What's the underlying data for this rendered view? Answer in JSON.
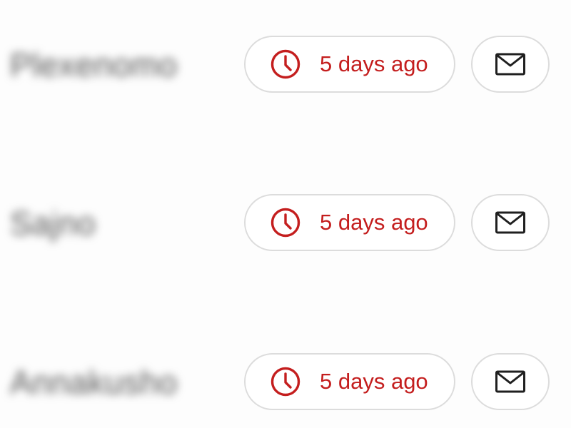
{
  "accent_color": "#c41e1e",
  "icon_color": "#1f1f1f",
  "rows": [
    {
      "name": "Plexenomo",
      "time_label": "5 days ago",
      "time_icon": "clock-icon",
      "mail_icon": "mail-icon"
    },
    {
      "name": "Sajno",
      "time_label": "5 days ago",
      "time_icon": "clock-icon",
      "mail_icon": "mail-icon"
    },
    {
      "name": "Annakusho",
      "time_label": "5 days ago",
      "time_icon": "clock-icon",
      "mail_icon": "mail-icon"
    }
  ]
}
